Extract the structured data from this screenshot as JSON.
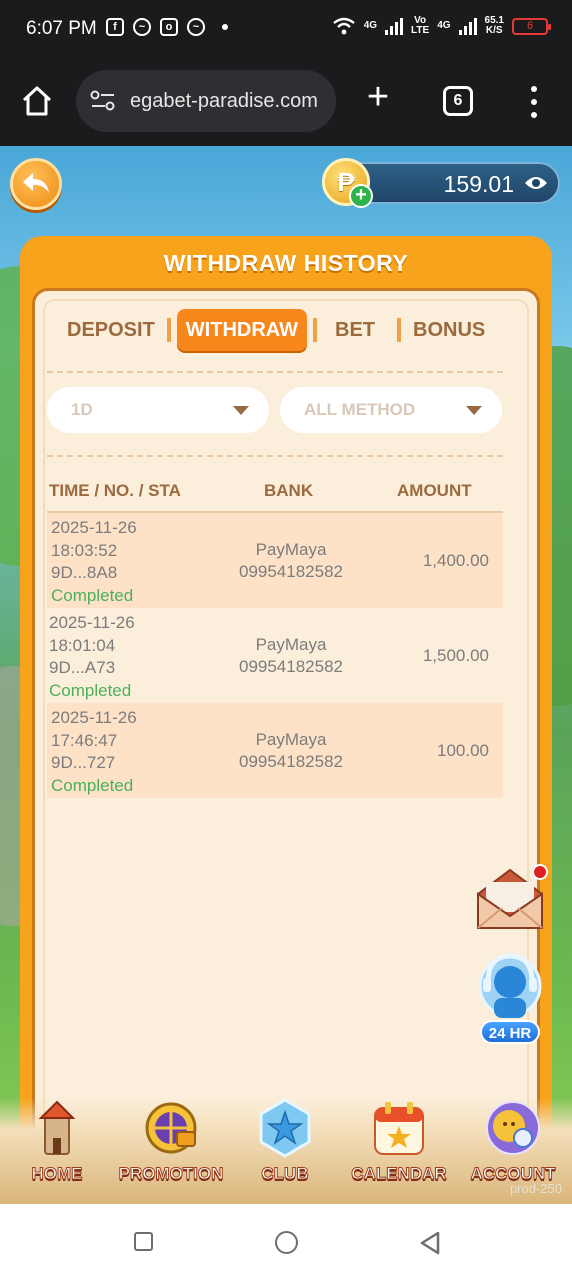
{
  "status_bar": {
    "time": "6:07 PM",
    "net_speed": "65.1",
    "net_speed_unit": "K/S",
    "battery": "6",
    "net1": "4G",
    "volte_top": "Vo",
    "volte_bottom": "LTE",
    "net2": "4G"
  },
  "browser": {
    "url": "egabet-paradise.com",
    "tab_count": "6"
  },
  "header": {
    "balance": "159.01",
    "currency_symbol": "₱"
  },
  "panel": {
    "title": "WITHDRAW HISTORY",
    "tabs": [
      {
        "label": "DEPOSIT",
        "active": false
      },
      {
        "label": "WITHDRAW",
        "active": true
      },
      {
        "label": "BET",
        "active": false
      },
      {
        "label": "BONUS",
        "active": false
      }
    ],
    "filters": {
      "period": "1D",
      "method": "ALL METHOD"
    },
    "columns": [
      "TIME / NO. / STA",
      "BANK",
      "AMOUNT"
    ],
    "rows": [
      {
        "date": "2025-11-26",
        "time": "18:03:52",
        "no": "9D...8A8",
        "status": "Completed",
        "bank": "PayMaya",
        "account": "09954182582",
        "amount": "1,400.00"
      },
      {
        "date": "2025-11-26",
        "time": "18:01:04",
        "no": "9D...A73",
        "status": "Completed",
        "bank": "PayMaya",
        "account": "09954182582",
        "amount": "1,500.00"
      },
      {
        "date": "2025-11-26",
        "time": "17:46:47",
        "no": "9D...727",
        "status": "Completed",
        "bank": "PayMaya",
        "account": "09954182582",
        "amount": "100.00"
      }
    ]
  },
  "support": {
    "label": "24 HR"
  },
  "nav": {
    "items": [
      {
        "label": "HOME",
        "icon": "castle-icon"
      },
      {
        "label": "PROMOTION",
        "icon": "wheel-icon"
      },
      {
        "label": "CLUB",
        "icon": "star-shield-icon"
      },
      {
        "label": "CALENDAR",
        "icon": "calendar-icon"
      },
      {
        "label": "ACCOUNT",
        "icon": "avatar-icon"
      }
    ],
    "prod_tag": "prod-250"
  },
  "colors": {
    "accent": "#f7861b",
    "panel": "#f7a31b",
    "completed": "#4cb05a"
  }
}
